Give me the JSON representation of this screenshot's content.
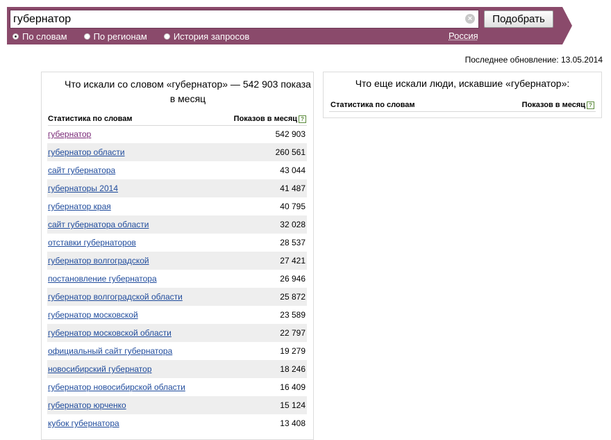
{
  "search": {
    "query": "губернатор",
    "clear_glyph": "×",
    "submit_label": "Подобрать"
  },
  "modes": [
    {
      "label": "По словам",
      "checked": true
    },
    {
      "label": "По регионам",
      "checked": false
    },
    {
      "label": "История запросов",
      "checked": false
    }
  ],
  "region": "Россия",
  "last_update": "Последнее обновление: 13.05.2014",
  "left_panel": {
    "title": "Что искали со словом «губернатор» — 542 903 показа в месяц",
    "col_words": "Статистика по словам",
    "col_shows": "Показов в месяц",
    "help_glyph": "?",
    "rows": [
      {
        "phrase": "губернатор",
        "count": "542 903"
      },
      {
        "phrase": "губернатор области",
        "count": "260 561"
      },
      {
        "phrase": "сайт губернатора",
        "count": "43 044"
      },
      {
        "phrase": "губернаторы 2014",
        "count": "41 487"
      },
      {
        "phrase": "губернатор края",
        "count": "40 795"
      },
      {
        "phrase": "сайт губернатора области",
        "count": "32 028"
      },
      {
        "phrase": "отставки губернаторов",
        "count": "28 537"
      },
      {
        "phrase": "губернатор волгоградской",
        "count": "27 421"
      },
      {
        "phrase": "постановление губернатора",
        "count": "26 946"
      },
      {
        "phrase": "губернатор волгоградской области",
        "count": "25 872"
      },
      {
        "phrase": "губернатор московской",
        "count": "23 589"
      },
      {
        "phrase": "губернатор московской области",
        "count": "22 797"
      },
      {
        "phrase": "официальный сайт губернатора",
        "count": "19 279"
      },
      {
        "phrase": "новосибирский губернатор",
        "count": "18 246"
      },
      {
        "phrase": "губернатор новосибирской области",
        "count": "16 409"
      },
      {
        "phrase": "губернатор юрченко",
        "count": "15 124"
      },
      {
        "phrase": "кубок губернатора",
        "count": "13 408"
      }
    ]
  },
  "right_panel": {
    "title": "Что еще искали люди, искавшие «губернатор»:",
    "col_words": "Статистика по словам",
    "col_shows": "Показов в месяц",
    "help_glyph": "?"
  },
  "colors": {
    "header_bg": "#8a4a6b",
    "link": "#1f4b9c",
    "visited_link": "#7a2a78",
    "row_alt": "#eeeeee"
  }
}
